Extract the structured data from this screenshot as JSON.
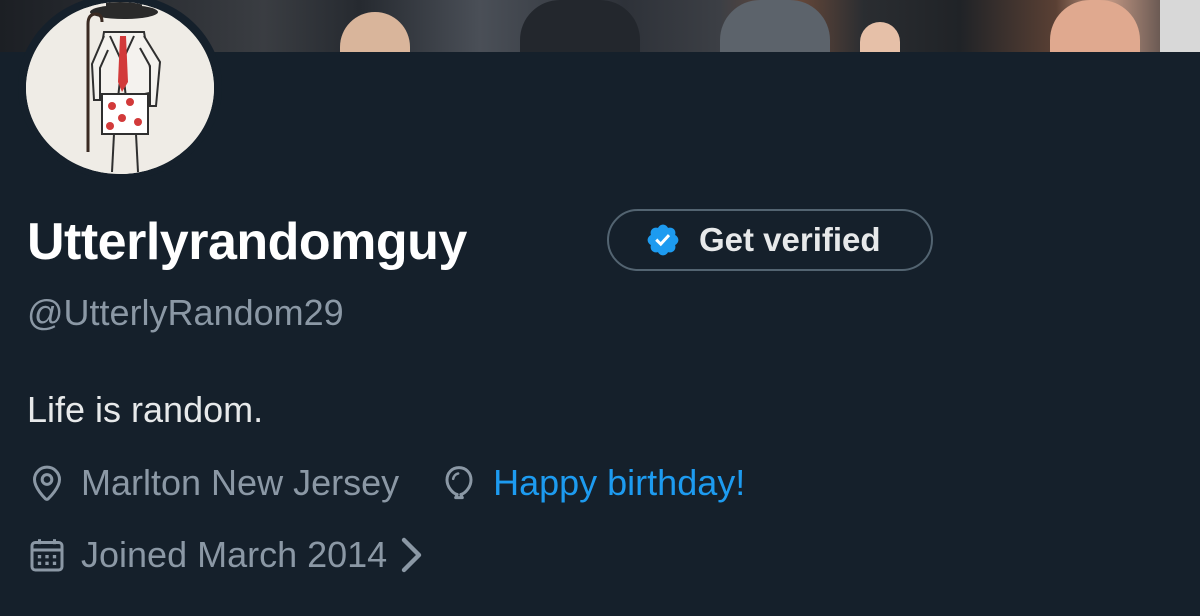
{
  "profile": {
    "display_name": "Utterlyrandomguy",
    "handle": "@UtterlyRandom29",
    "bio": "Life is random.",
    "location": "Marlton New Jersey",
    "birthday_text": "Happy birthday!",
    "joined": "Joined March 2014"
  },
  "verify": {
    "label": "Get verified",
    "icon": "verified-check-icon"
  },
  "icons": {
    "location": "location-pin-icon",
    "birthday": "balloon-icon",
    "joined": "calendar-icon",
    "joined_more": "chevron-right-icon"
  },
  "colors": {
    "background": "#15202b",
    "accent": "#1d9bf0",
    "muted": "#8b98a5",
    "text": "#e7e9ea"
  }
}
